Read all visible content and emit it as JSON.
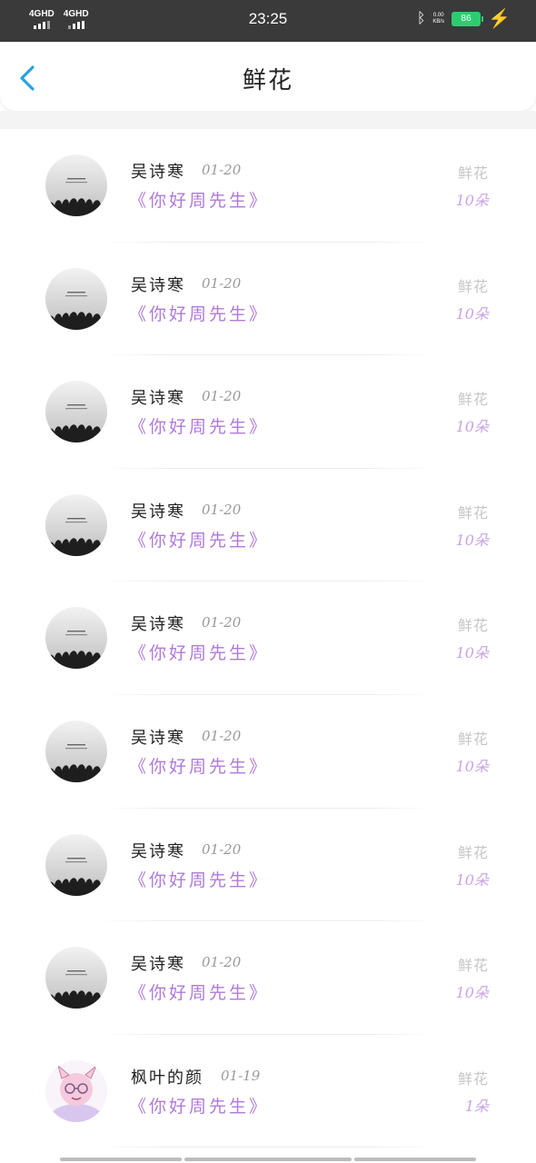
{
  "status_bar": {
    "network_1": "4GHD",
    "network_2": "4GHD",
    "time": "23:25",
    "speed_value": "0.00",
    "speed_unit": "KB/s",
    "battery": "86"
  },
  "header": {
    "title": "鲜花",
    "back_icon": "chevron-left-icon",
    "accent_color": "#2aa2e0"
  },
  "colors": {
    "song": "#b07ad8",
    "count": "#c8a4e4",
    "gift_type": "#c6c6c6"
  },
  "items": [
    {
      "user": "吴诗寒",
      "date": "01-20",
      "song": "《你好周先生》",
      "gift_type": "鲜花",
      "count": "10朵",
      "avatar": "crowd-photo"
    },
    {
      "user": "吴诗寒",
      "date": "01-20",
      "song": "《你好周先生》",
      "gift_type": "鲜花",
      "count": "10朵",
      "avatar": "crowd-photo"
    },
    {
      "user": "吴诗寒",
      "date": "01-20",
      "song": "《你好周先生》",
      "gift_type": "鲜花",
      "count": "10朵",
      "avatar": "crowd-photo"
    },
    {
      "user": "吴诗寒",
      "date": "01-20",
      "song": "《你好周先生》",
      "gift_type": "鲜花",
      "count": "10朵",
      "avatar": "crowd-photo"
    },
    {
      "user": "吴诗寒",
      "date": "01-20",
      "song": "《你好周先生》",
      "gift_type": "鲜花",
      "count": "10朵",
      "avatar": "crowd-photo"
    },
    {
      "user": "吴诗寒",
      "date": "01-20",
      "song": "《你好周先生》",
      "gift_type": "鲜花",
      "count": "10朵",
      "avatar": "crowd-photo"
    },
    {
      "user": "吴诗寒",
      "date": "01-20",
      "song": "《你好周先生》",
      "gift_type": "鲜花",
      "count": "10朵",
      "avatar": "crowd-photo"
    },
    {
      "user": "吴诗寒",
      "date": "01-20",
      "song": "《你好周先生》",
      "gift_type": "鲜花",
      "count": "10朵",
      "avatar": "crowd-photo"
    },
    {
      "user": "枫叶的颜",
      "date": "01-19",
      "song": "《你好周先生》",
      "gift_type": "鲜花",
      "count": "1朵",
      "avatar": "cartoon-character"
    }
  ]
}
